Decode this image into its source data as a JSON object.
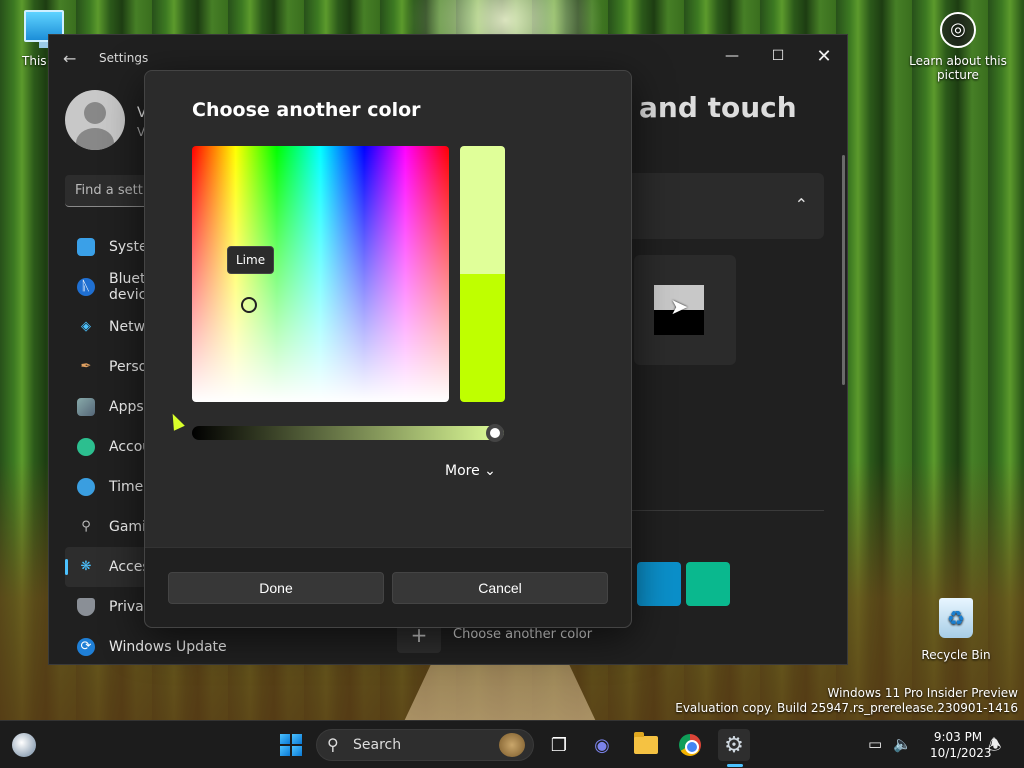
{
  "desktop": {
    "this_pc_label": "This PC",
    "learn_label": "Learn about this picture",
    "recycle_label": "Recycle Bin",
    "watermark_line1": "Windows 11 Pro Insider Preview",
    "watermark_line2": "Evaluation copy. Build 25947.rs_prerelease.230901-1416"
  },
  "settings": {
    "title": "Settings",
    "user_initial": "V",
    "user_initial2": "V",
    "find_placeholder": "Find a setting",
    "page_title": "and touch",
    "nav": [
      {
        "label": "System",
        "icon": "monitor-icon"
      },
      {
        "label": "Bluetooth & devices",
        "icon": "bluetooth-icon"
      },
      {
        "label": "Network & internet",
        "icon": "wifi-icon"
      },
      {
        "label": "Personalization",
        "icon": "brush-icon"
      },
      {
        "label": "Apps",
        "icon": "apps-icon"
      },
      {
        "label": "Accounts",
        "icon": "person-icon"
      },
      {
        "label": "Time & language",
        "icon": "clock-icon"
      },
      {
        "label": "Gaming",
        "icon": "gamepad-icon"
      },
      {
        "label": "Accessibility",
        "icon": "accessibility-icon"
      },
      {
        "label": "Privacy & security",
        "icon": "shield-icon"
      },
      {
        "label": "Windows Update",
        "icon": "update-icon"
      }
    ],
    "another_color_label": "Choose another color",
    "swatch_colors": [
      "#0b8fc9",
      "#0ab88e"
    ]
  },
  "dialog": {
    "title": "Choose another color",
    "tooltip": "Lime",
    "preview_new_color": "#e0ff99",
    "preview_current_color": "#bfff00",
    "value_level": 1.0,
    "more_label": "More",
    "done_label": "Done",
    "cancel_label": "Cancel"
  },
  "taskbar": {
    "search_label": "Search",
    "time": "9:03 PM",
    "date": "10/1/2023"
  },
  "colors": {
    "accent": "#4cc2ff",
    "dialog_bg": "#2b2b2b",
    "window_bg": "#202020"
  }
}
